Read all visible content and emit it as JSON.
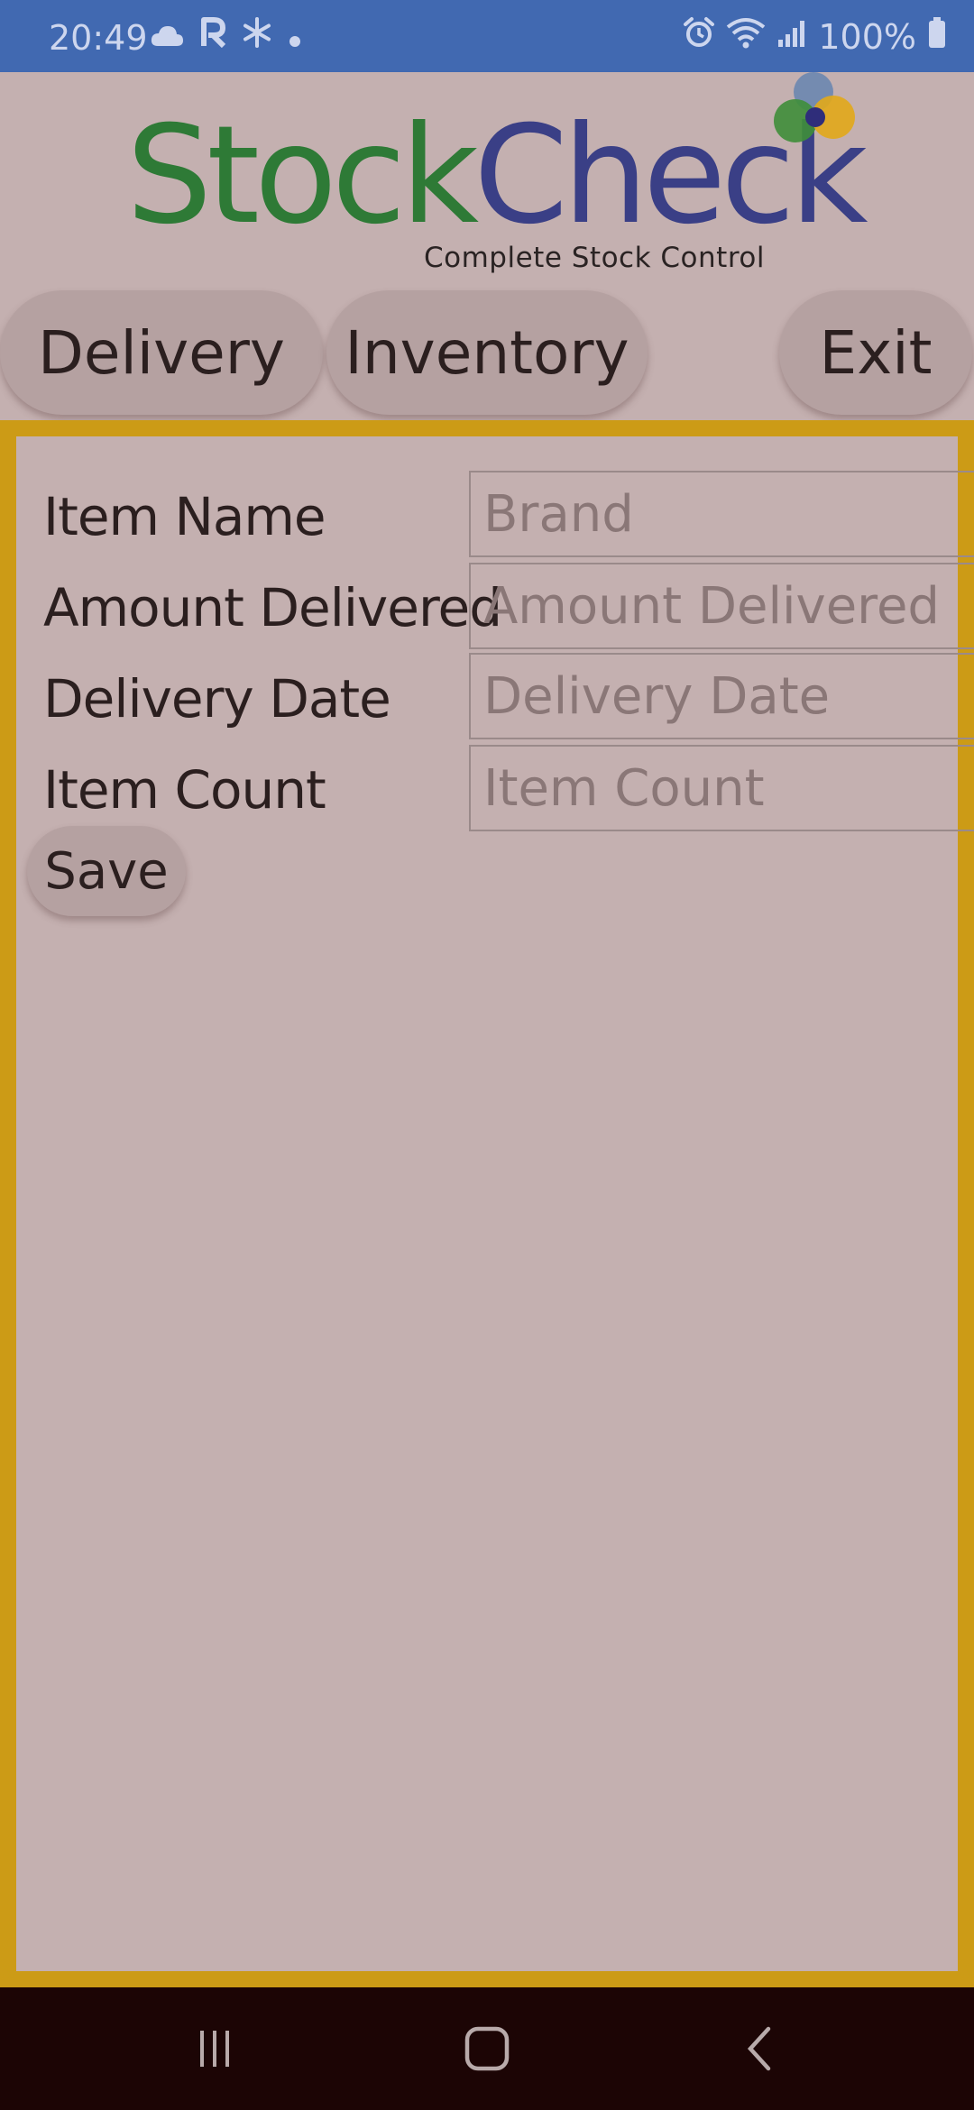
{
  "status_bar": {
    "time": "20:49",
    "left_icons": [
      "cloud-icon",
      "r-app-icon",
      "snowflake-icon",
      "dot-icon"
    ],
    "right_icons": [
      "alarm-icon",
      "wifi-icon",
      "signal-icon",
      "battery-icon"
    ],
    "battery_percent": "100%"
  },
  "logo": {
    "word_part1": "Stock",
    "word_part2": "Check",
    "tagline": "Complete Stock Control",
    "colors": {
      "stock": "#2e7a36",
      "check": "#3a3f86",
      "dot_blue": "#5a7fb0",
      "dot_green": "#3f8e3a",
      "dot_yellow": "#e2a91a",
      "dot_navy": "#2f2d7a"
    }
  },
  "nav": {
    "delivery_label": "Delivery",
    "inventory_label": "Inventory",
    "exit_label": "Exit"
  },
  "form": {
    "rows": [
      {
        "label": "Item Name",
        "placeholder": "Brand"
      },
      {
        "label": "Amount Delivered",
        "placeholder": "Amount Delivered"
      },
      {
        "label": "Delivery Date",
        "placeholder": "Delivery Date"
      },
      {
        "label": "Item Count",
        "placeholder": "Item Count"
      }
    ],
    "save_label": "Save"
  },
  "theme": {
    "status_bar_bg": "#4169b1",
    "background": "#c4b0b0",
    "panel_border": "#cc9b16",
    "nav_bar_bg": "#1c0505"
  },
  "system_nav": {
    "icons": [
      "recent-apps-icon",
      "home-icon",
      "back-icon"
    ]
  }
}
